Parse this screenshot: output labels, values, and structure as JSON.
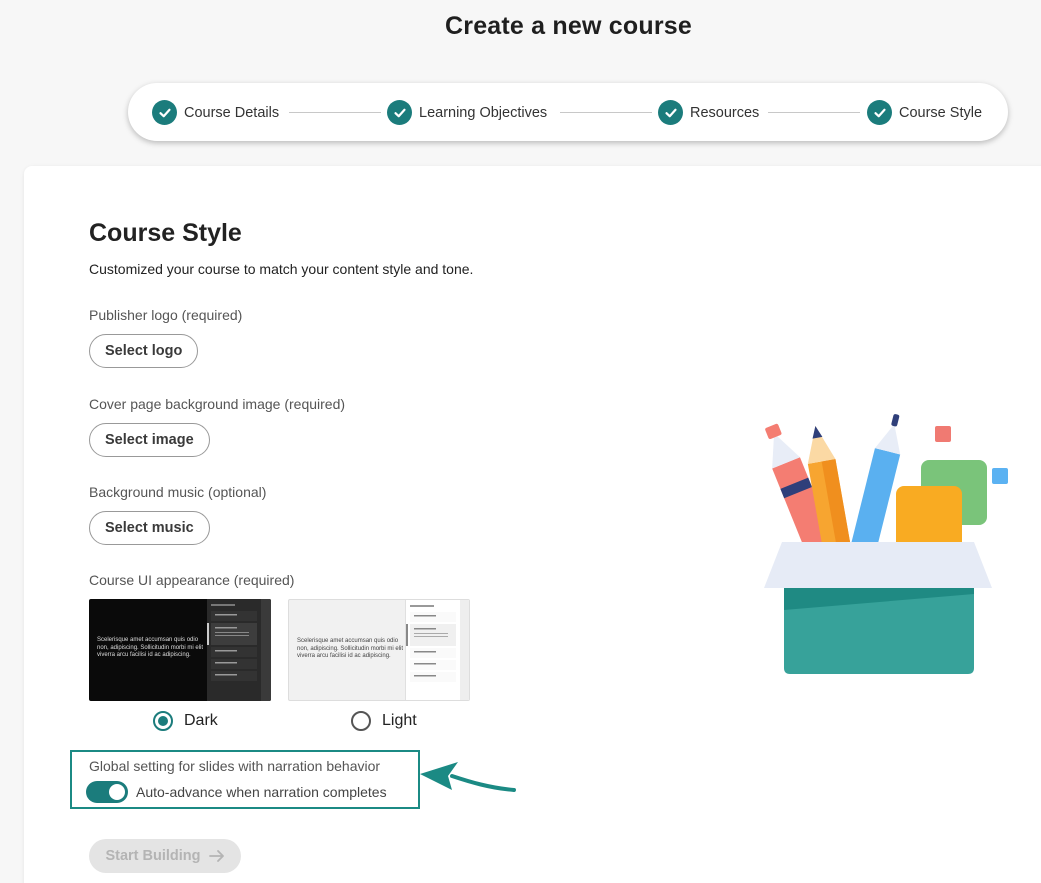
{
  "page": {
    "title": "Create a new course"
  },
  "stepper": {
    "steps": [
      {
        "label": "Course Details",
        "status": "complete"
      },
      {
        "label": "Learning Objectives",
        "status": "complete"
      },
      {
        "label": "Resources",
        "status": "complete"
      },
      {
        "label": "Course Style",
        "status": "complete"
      }
    ]
  },
  "form": {
    "title": "Course Style",
    "description": "Customized your course to match your content style and tone.",
    "logo": {
      "label": "Publisher logo (required)",
      "button": "Select logo"
    },
    "cover": {
      "label": "Cover page background image (required)",
      "button": "Select image"
    },
    "music": {
      "label": "Background music (optional)",
      "button": "Select music"
    },
    "appearance": {
      "label": "Course UI appearance (required)",
      "preview_text": "Scelerisque amet accumsan quis odio non, adipiscing. Sollicitudin morbi mi elit viverra arcu facilisi id ac adipiscing.",
      "options": [
        {
          "label": "Dark",
          "selected": true
        },
        {
          "label": "Light",
          "selected": false
        }
      ]
    },
    "narration": {
      "label": "Global setting for slides with narration behavior",
      "toggle_label": "Auto-advance when narration completes",
      "toggle_on": true
    },
    "start_button": "Start Building"
  },
  "colors": {
    "accent": "#1b7c7c",
    "highlight": "#1b8a84"
  },
  "icons": [
    "check-icon",
    "arrow-right-icon",
    "callout-arrow-icon"
  ]
}
